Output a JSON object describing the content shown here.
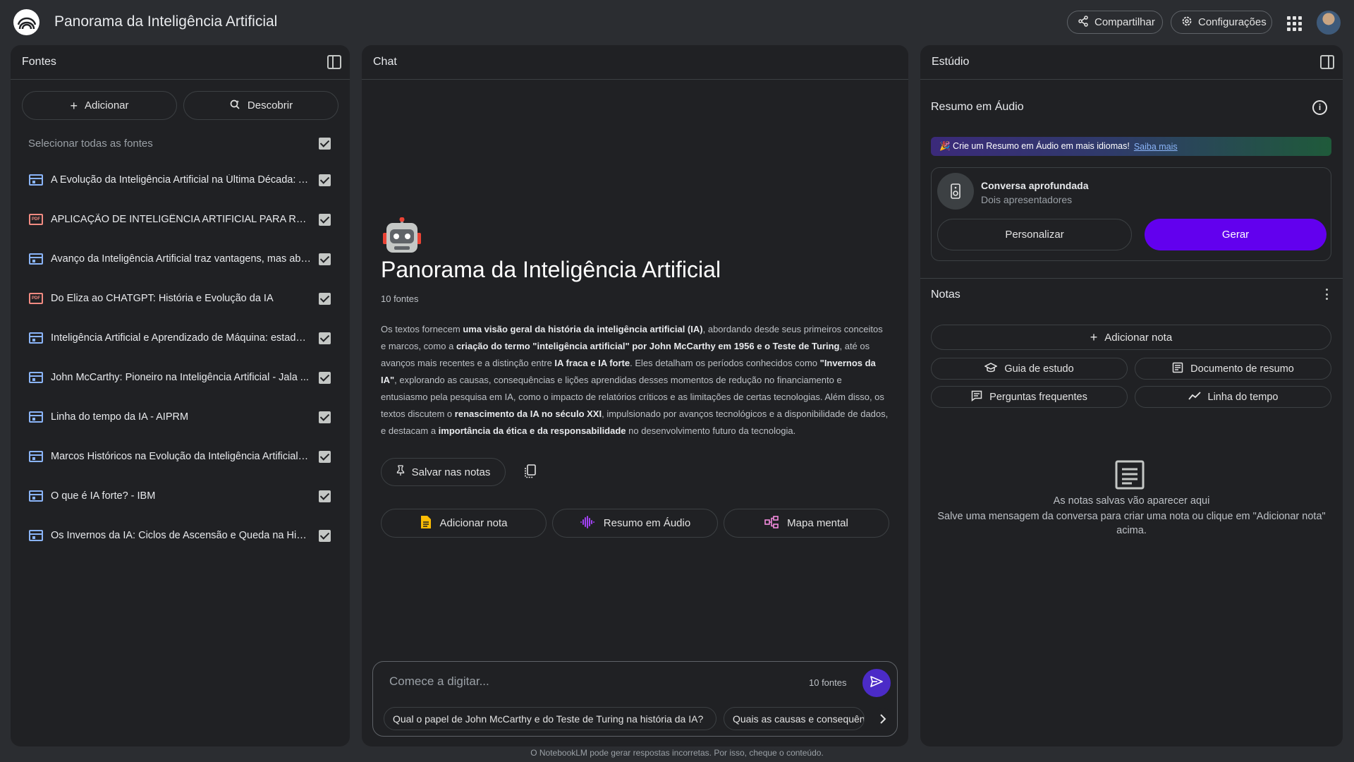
{
  "app": {
    "title": "Panorama da Inteligência Artificial",
    "share_label": "Compartilhar",
    "settings_label": "Configurações"
  },
  "sources": {
    "header": "Fontes",
    "add_label": "Adicionar",
    "discover_label": "Descobrir",
    "select_all_label": "Selecionar todas as fontes",
    "items": [
      {
        "label": "A Evolução da Inteligência Artificial na Última Década: A...",
        "icon": "web-source-icon"
      },
      {
        "label": "APLICAÇÃO DE INTELIGÊNCIA ARTIFICIAL PARA ROBÓTI...",
        "icon": "pdf-icon"
      },
      {
        "label": "Avanço da Inteligência Artificial traz vantagens, mas abr...",
        "icon": "web-source-icon"
      },
      {
        "label": "Do Eliza ao CHATGPT: História e Evolução da IA",
        "icon": "pdf-icon"
      },
      {
        "label": "Inteligência Artificial e Aprendizado de Máquina: estado ...",
        "icon": "web-source-icon"
      },
      {
        "label": "John McCarthy: Pioneiro na Inteligência Artificial - Jala ...",
        "icon": "web-source-icon"
      },
      {
        "label": "Linha do tempo da IA - AIPRM",
        "icon": "web-source-icon"
      },
      {
        "label": "Marcos Históricos na Evolução da Inteligência Artificial -...",
        "icon": "web-source-icon"
      },
      {
        "label": "O que é IA forte? - IBM",
        "icon": "web-source-icon"
      },
      {
        "label": "Os Invernos da IA: Ciclos de Ascensão e Queda na Histó...",
        "icon": "web-source-icon"
      }
    ]
  },
  "chat": {
    "header": "Chat",
    "notebook_title": "Panorama da Inteligência Artificial",
    "source_count": "10 fontes",
    "summary_parts": [
      {
        "t": "Os textos fornecem ",
        "b": false
      },
      {
        "t": "uma visão geral da história da inteligência artificial (IA)",
        "b": true
      },
      {
        "t": ", abordando desde seus primeiros conceitos e marcos, como a ",
        "b": false
      },
      {
        "t": "criação do termo \"inteligência artificial\" por John McCarthy em 1956 e o Teste de Turing",
        "b": true
      },
      {
        "t": ", até os avanços mais recentes e a distinção entre ",
        "b": false
      },
      {
        "t": "IA fraca e IA forte",
        "b": true
      },
      {
        "t": ". Eles detalham os períodos conhecidos como ",
        "b": false
      },
      {
        "t": "\"Invernos da IA\"",
        "b": true
      },
      {
        "t": ", explorando as causas, consequências e lições aprendidas desses momentos de redução no financiamento e entusiasmo pela pesquisa em IA, como o impacto de relatórios críticos e as limitações de certas tecnologias. Além disso, os textos discutem o ",
        "b": false
      },
      {
        "t": "renascimento da IA no século XXI",
        "b": true
      },
      {
        "t": ", impulsionado por avanços tecnológicos e a disponibilidade de dados, e destacam a ",
        "b": false
      },
      {
        "t": "importância da ética e da responsabilidade",
        "b": true
      },
      {
        "t": " no desenvolvimento futuro da tecnologia.",
        "b": false
      }
    ],
    "save_label": "Salvar nas notas",
    "actions": [
      {
        "label": "Adicionar nota",
        "icon": "note-icon"
      },
      {
        "label": "Resumo em Áudio",
        "icon": "audio-wave-icon"
      },
      {
        "label": "Mapa mental",
        "icon": "mind-map-icon"
      }
    ],
    "input_placeholder": "Comece a digitar...",
    "input_source_count": "10 fontes",
    "suggestions": [
      "Qual o papel de John McCarthy e do Teste de Turing na história da IA?",
      "Quais as causas e consequências"
    ]
  },
  "studio": {
    "header": "Estúdio",
    "audio_title": "Resumo em Áudio",
    "promo_text": "🎉 Crie um Resumo em Áudio em mais idiomas!",
    "promo_link": "Saiba mais",
    "audio_card_title": "Conversa aprofundada",
    "audio_card_sub": "Dois apresentadores",
    "personalize_label": "Personalizar",
    "generate_label": "Gerar",
    "notes_title": "Notas",
    "add_note_label": "Adicionar nota",
    "note_chips": [
      {
        "label": "Guia de estudo",
        "icon": "graduation-cap-icon"
      },
      {
        "label": "Documento de resumo",
        "icon": "document-icon"
      },
      {
        "label": "Perguntas frequentes",
        "icon": "faq-icon"
      },
      {
        "label": "Linha do tempo",
        "icon": "timeline-icon"
      }
    ],
    "empty_title": "As notas salvas vão aparecer aqui",
    "empty_desc": "Salve uma mensagem da conversa para criar uma nota ou clique em \"Adicionar nota\" acima."
  },
  "footer": "O NotebookLM pode gerar respostas incorretas. Por isso, cheque o conteúdo.",
  "colors": {
    "background": "#2b2d31",
    "panel": "#202124",
    "accent_purple": "#6200ee",
    "web_icon": "#8ab4f8",
    "pdf_icon": "#f28b82"
  }
}
